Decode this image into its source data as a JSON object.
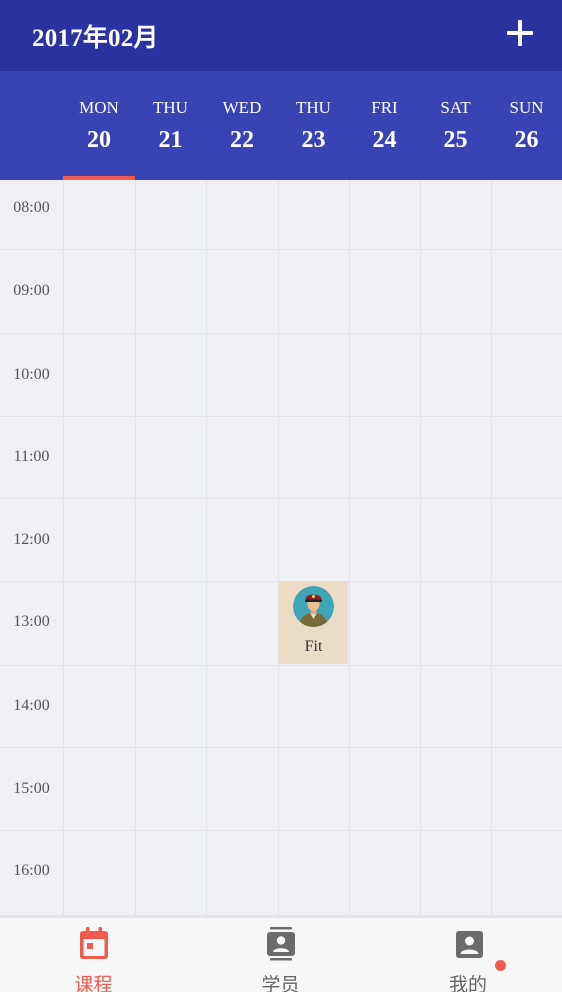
{
  "header": {
    "month_title": "2017年02月",
    "add_icon": "plus-icon"
  },
  "week": {
    "days": [
      {
        "name": "MON",
        "date": "20",
        "selected": true
      },
      {
        "name": "THU",
        "date": "21",
        "selected": false
      },
      {
        "name": "WED",
        "date": "22",
        "selected": false
      },
      {
        "name": "THU",
        "date": "23",
        "selected": false
      },
      {
        "name": "FRI",
        "date": "24",
        "selected": false
      },
      {
        "name": "SAT",
        "date": "25",
        "selected": false
      },
      {
        "name": "SUN",
        "date": "26",
        "selected": false
      }
    ]
  },
  "schedule": {
    "times": [
      "08:00",
      "09:00",
      "10:00",
      "11:00",
      "12:00",
      "13:00",
      "14:00",
      "15:00",
      "16:00"
    ],
    "events": [
      {
        "name": "Fit",
        "day": "23",
        "time": "13:00"
      }
    ]
  },
  "tabs": [
    {
      "label": "课程",
      "icon": "calendar-icon",
      "active": true
    },
    {
      "label": "学员",
      "icon": "contacts-icon",
      "active": false
    },
    {
      "label": "我的",
      "icon": "account-box-icon",
      "active": false,
      "badge": true
    }
  ],
  "colors": {
    "primary": "#2a34a0",
    "week_bar": "#3944b4",
    "accent": "#f15a4f",
    "event_bg": "#ecdcc6"
  }
}
